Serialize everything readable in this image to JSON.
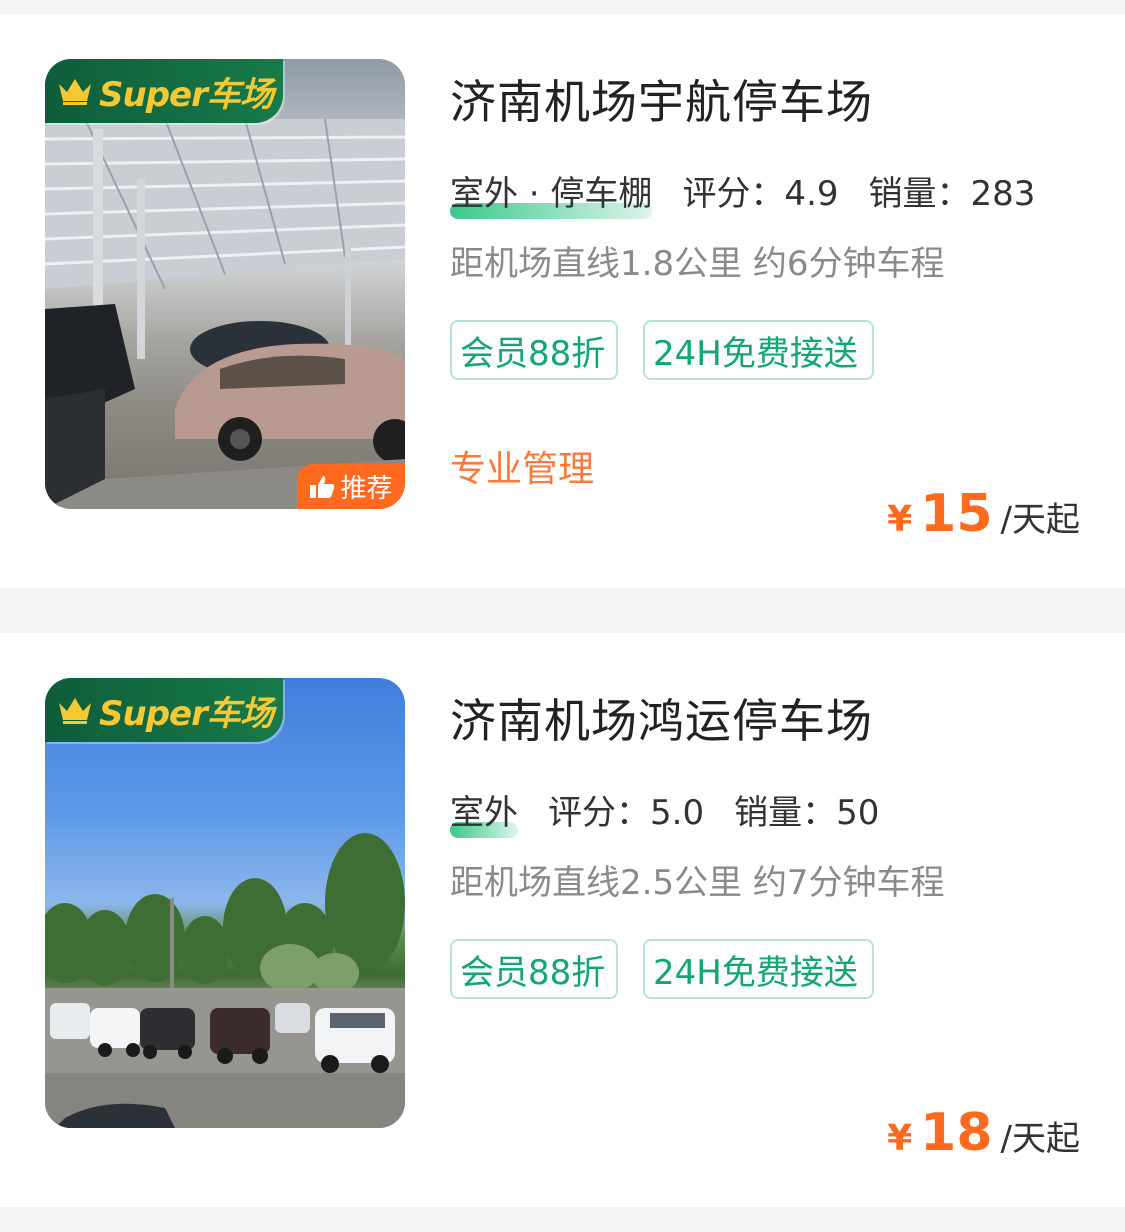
{
  "lots": [
    {
      "badge": "Super车场",
      "recommend": "推荐",
      "title": "济南机场宇航停车场",
      "type": "室外 · 停车棚",
      "rating": "评分：4.9",
      "sales": "销量：283",
      "distance": "距机场直线1.8公里 约6分钟车程",
      "tags": [
        "会员88折",
        "24H免费接送"
      ],
      "feature": "专业管理",
      "price": {
        "currency": "¥",
        "amount": "15",
        "unit": "/天起"
      }
    },
    {
      "badge": "Super车场",
      "title": "济南机场鸿运停车场",
      "type": "室外",
      "rating": "评分：5.0",
      "sales": "销量：50",
      "distance": "距机场直线2.5公里 约7分钟车程",
      "tags": [
        "会员88折",
        "24H免费接送"
      ],
      "price": {
        "currency": "¥",
        "amount": "18",
        "unit": "/天起"
      }
    }
  ],
  "colors": {
    "accent_green": "#12a672",
    "badge_green": "#0d5d3a",
    "accent_orange": "#ff6a1f",
    "crown_gold": "#f6c934"
  }
}
